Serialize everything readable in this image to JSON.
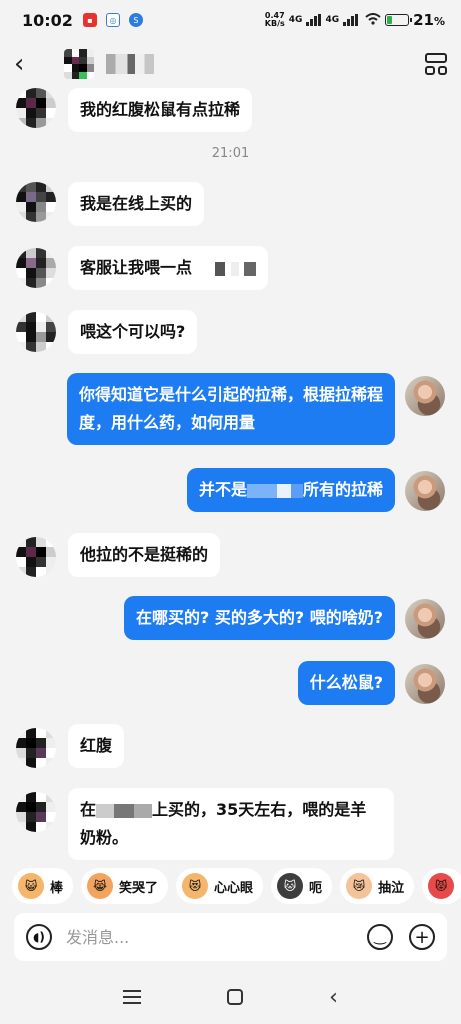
{
  "status": {
    "time": "10:02",
    "net_speed_top": "0.47",
    "net_speed_bottom": "KB/s",
    "net1": "4G",
    "net2": "4G",
    "battery_pct": "21",
    "battery_level": 0.21
  },
  "nav": {
    "back_icon": "chevron-left-icon",
    "menu_icon": "grid-icon"
  },
  "messages": [
    {
      "side": "left",
      "text": "我的红腹松鼠有点拉稀"
    },
    {
      "timestamp": "21:01"
    },
    {
      "side": "left",
      "text": "我是在线上买的"
    },
    {
      "side": "left",
      "text": "客服让我喂一点"
    },
    {
      "side": "left",
      "text": "喂这个可以吗?"
    },
    {
      "side": "right",
      "text": "你得知道它是什么引起的拉稀，根据拉稀程度，用什么药，如何用量"
    },
    {
      "side": "right",
      "text_a": "并不是",
      "text_b": "所有的拉稀"
    },
    {
      "side": "left",
      "text": "他拉的不是挺稀的"
    },
    {
      "side": "right",
      "text": "在哪买的? 买的多大的? 喂的啥奶?"
    },
    {
      "side": "right",
      "text": "什么松鼠?"
    },
    {
      "side": "left",
      "text": "红腹"
    },
    {
      "side": "left",
      "text_a": "在",
      "text_b": "上买的，35天左右，喂的是羊奶粉。"
    }
  ],
  "reactions": [
    {
      "label": "棒",
      "color": "#f5b56b"
    },
    {
      "label": "笑哭了",
      "color": "#f2a35e"
    },
    {
      "label": "心心眼",
      "color": "#f5b56b"
    },
    {
      "label": "呃",
      "color": "#3d3d3d"
    },
    {
      "label": "抽泣",
      "color": "#f5c39a"
    },
    {
      "label": "",
      "color": "#e84a4a"
    }
  ],
  "input": {
    "placeholder": "发消息...",
    "voice_icon": "voice-icon",
    "emoji_icon": "emoji-icon",
    "plus_icon": "plus-icon"
  }
}
